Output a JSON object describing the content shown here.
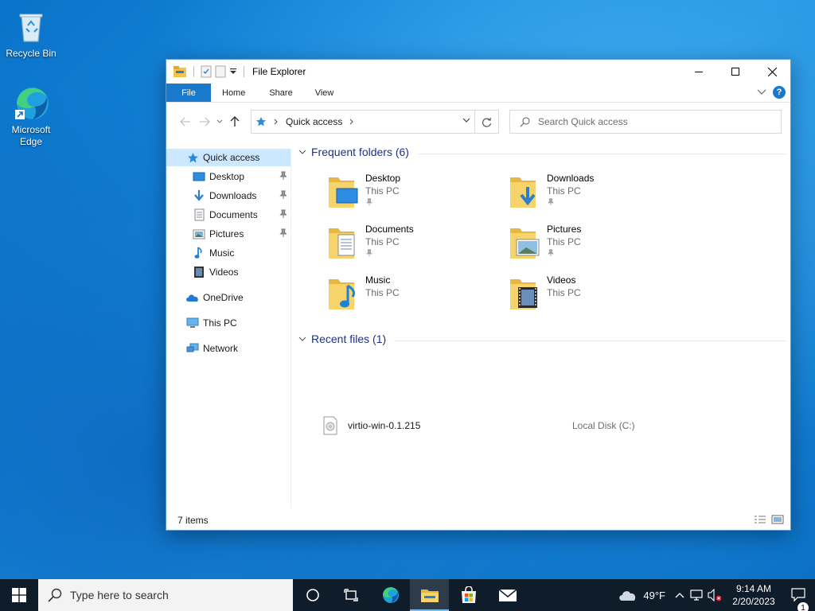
{
  "desktop": {
    "icons": [
      {
        "label": "Recycle Bin"
      },
      {
        "label": "Microsoft Edge"
      }
    ]
  },
  "window": {
    "title": "File Explorer",
    "ribbon_tabs": [
      "File",
      "Home",
      "Share",
      "View"
    ],
    "address": {
      "crumb": "Quick access"
    },
    "search": {
      "placeholder": "Search Quick access"
    },
    "nav": [
      {
        "label": "Quick access",
        "icon": "star-icon",
        "selected": true
      },
      {
        "label": "Desktop",
        "icon": "desktop-folder-icon",
        "pinned": true
      },
      {
        "label": "Downloads",
        "icon": "downloads-icon",
        "pinned": true
      },
      {
        "label": "Documents",
        "icon": "documents-icon",
        "pinned": true
      },
      {
        "label": "Pictures",
        "icon": "pictures-icon",
        "pinned": true
      },
      {
        "label": "Music",
        "icon": "music-icon"
      },
      {
        "label": "Videos",
        "icon": "videos-icon"
      },
      {
        "label": "OneDrive",
        "icon": "onedrive-icon"
      },
      {
        "label": "This PC",
        "icon": "this-pc-icon"
      },
      {
        "label": "Network",
        "icon": "network-icon"
      }
    ],
    "frequent": {
      "header": "Frequent folders (6)",
      "folders": [
        {
          "name": "Desktop",
          "location": "This PC",
          "pinned": true
        },
        {
          "name": "Downloads",
          "location": "This PC",
          "pinned": true
        },
        {
          "name": "Documents",
          "location": "This PC",
          "pinned": true
        },
        {
          "name": "Pictures",
          "location": "This PC",
          "pinned": true
        },
        {
          "name": "Music",
          "location": "This PC"
        },
        {
          "name": "Videos",
          "location": "This PC"
        }
      ]
    },
    "recent": {
      "header": "Recent files (1)",
      "files": [
        {
          "name": "virtio-win-0.1.215",
          "location": "Local Disk (C:)"
        }
      ]
    },
    "status": "7 items"
  },
  "taskbar": {
    "search_placeholder": "Type here to search",
    "weather": "49°F",
    "time": "9:14 AM",
    "date": "2/20/2023",
    "notifications": "1"
  },
  "colors": {
    "accent": "#1979ca",
    "selected": "#cce8ff",
    "group_header": "#1e3287",
    "taskbar": "#0f1d2b"
  }
}
